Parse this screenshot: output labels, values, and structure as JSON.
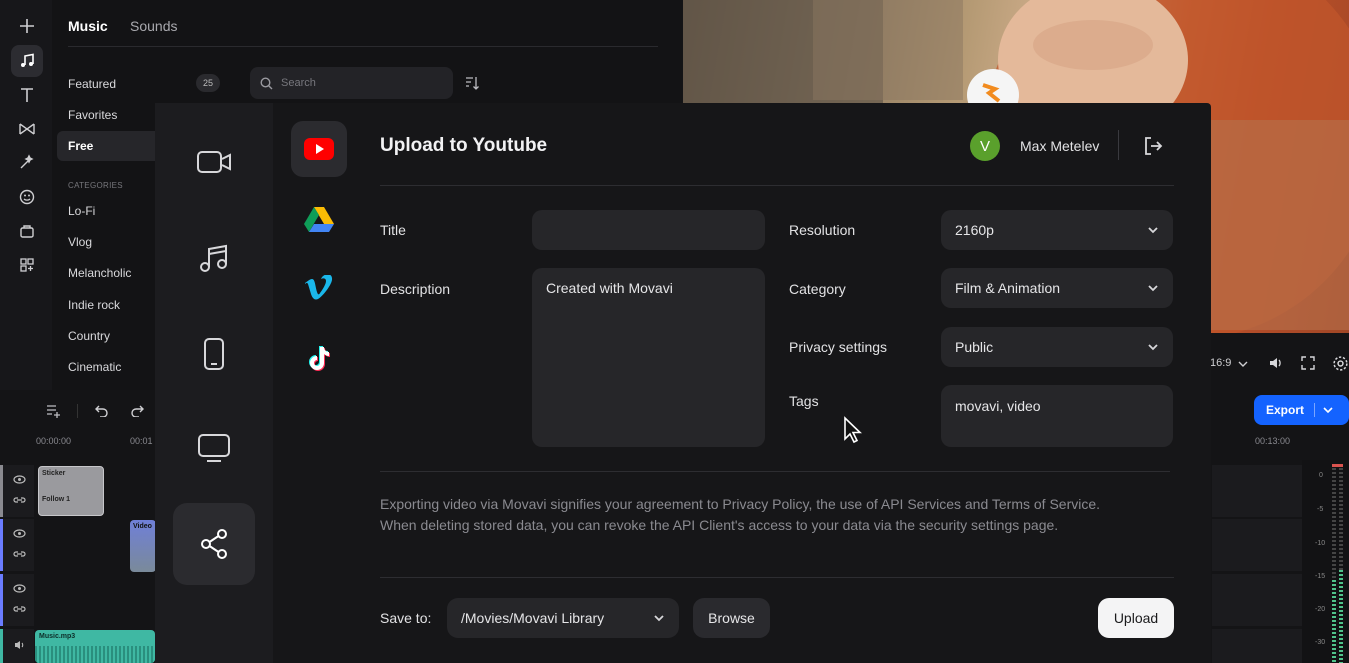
{
  "library": {
    "tabs": [
      "Music",
      "Sounds"
    ],
    "items": [
      "Featured",
      "Favorites",
      "Free"
    ],
    "featured_count": "25",
    "categories_heading": "CATEGORIES",
    "categories": [
      "Lo-Fi",
      "Vlog",
      "Melancholic",
      "Indie rock",
      "Country",
      "Cinematic"
    ],
    "search_placeholder": "Search"
  },
  "timeline": {
    "time_start": "00:00:00",
    "time_next": "00:01",
    "time_right": "00:13:00",
    "clip_sticker_title": "Sticker",
    "clip_sticker_sub": "Follow 1",
    "clip_video": "Video",
    "clip_music": "Music.mp3",
    "meter_labels": [
      "0",
      "-5",
      "-10",
      "-15",
      "-20",
      "-30"
    ]
  },
  "player": {
    "aspect": "16:9",
    "export_label": "Export"
  },
  "modal": {
    "title": "Upload to Youtube",
    "user_initial": "V",
    "user_name": "Max Metelev",
    "fields": {
      "title_label": "Title",
      "title_value": "",
      "description_label": "Description",
      "description_value": "Created with Movavi",
      "resolution_label": "Resolution",
      "resolution_value": "2160p",
      "category_label": "Category",
      "category_value": "Film & Animation",
      "privacy_label": "Privacy settings",
      "privacy_value": "Public",
      "tags_label": "Tags",
      "tags_value": "movavi, video"
    },
    "notice_line1": "Exporting video via Movavi signifies your agreement to Privacy Policy, the use of API Services and Terms of Service.",
    "notice_line2": "When deleting stored data, you can revoke the API Client's access to your data via the security settings page.",
    "save_to_label": "Save to:",
    "save_path": "/Movies/Movavi Library",
    "browse_label": "Browse",
    "upload_label": "Upload"
  },
  "colors": {
    "accent_blue": "#1463ff",
    "youtube_red": "#ff0000",
    "vimeo_blue": "#1ab7ea",
    "avatar_green": "#5aa02c",
    "music_clip": "#3fb8a3",
    "sticker_clip": "#9a9a9e"
  },
  "icons": [
    "plus-icon",
    "music-note-icon",
    "text-icon",
    "transition-icon",
    "magic-icon",
    "emoji-icon",
    "stickers-icon",
    "apps-icon",
    "search-icon",
    "sort-icon",
    "video-camera-icon",
    "music-icon",
    "mobile-icon",
    "monitor-icon",
    "share-icon",
    "youtube-icon",
    "google-drive-icon",
    "vimeo-icon",
    "tiktok-icon",
    "logout-icon",
    "chevron-down-icon",
    "cursor-icon",
    "eye-icon",
    "link-icon",
    "undo-icon",
    "redo-icon",
    "add-track-icon",
    "volume-icon",
    "fullscreen-icon",
    "settings-icon"
  ]
}
